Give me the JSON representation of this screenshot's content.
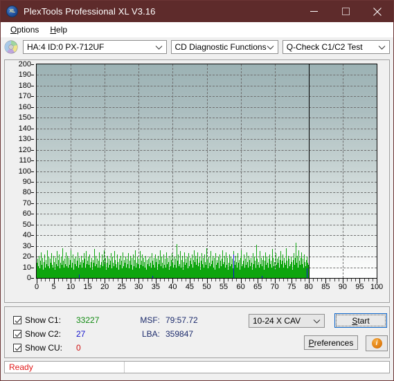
{
  "window": {
    "title": "PlexTools Professional XL V3.16",
    "app_icon": "xl-disc-icon",
    "icon_text": "XL",
    "minimize_label": "Minimize",
    "maximize_label": "Maximize",
    "close_label": "Close"
  },
  "menu": {
    "items": [
      {
        "label": "Options",
        "accel": "O"
      },
      {
        "label": "Help",
        "accel": "H"
      }
    ]
  },
  "toolbar": {
    "drive_select": "HA:4 ID:0  PX-712UF",
    "function_select": "CD Diagnostic Functions",
    "test_select": "Q-Check C1/C2 Test"
  },
  "stats": {
    "checkboxes": [
      {
        "label": "Show C1:",
        "value": "33227",
        "color": "#128a12",
        "checked": true
      },
      {
        "label": "Show C2:",
        "value": "27",
        "color": "#1212cc",
        "checked": true
      },
      {
        "label": "Show CU:",
        "value": "0",
        "color": "#d01010",
        "checked": true
      }
    ],
    "msf_label": "MSF:",
    "msf_value": "79:57.72",
    "lba_label": "LBA:",
    "lba_value": "359847",
    "speed_select": "10-24 X CAV",
    "start_label": "Start",
    "start_accel": "S",
    "preferences_label": "Preferences",
    "preferences_accel": "P",
    "info_label": "i"
  },
  "statusbar": {
    "text": "Ready"
  },
  "chart_data": {
    "type": "bar",
    "title": "",
    "xlabel": "",
    "ylabel": "",
    "xlim": [
      0,
      100
    ],
    "ylim": [
      0,
      200
    ],
    "grid": true,
    "legend_position": "below-chart",
    "x_ticks": [
      0,
      5,
      10,
      15,
      20,
      25,
      30,
      35,
      40,
      45,
      50,
      55,
      60,
      65,
      70,
      75,
      80,
      85,
      90,
      95,
      100
    ],
    "y_ticks": [
      0,
      10,
      20,
      30,
      40,
      50,
      60,
      70,
      80,
      90,
      100,
      110,
      120,
      130,
      140,
      150,
      160,
      170,
      180,
      190,
      200
    ],
    "x_minor_step": 1.25,
    "data_end_x": 80,
    "marker_lines_x": [
      80
    ],
    "plot_bg_top": "#9cb2b4",
    "plot_bg_bottom": "#ffffff",
    "series": [
      {
        "name": "C1",
        "color": "#0ea50e",
        "total": 33227,
        "note": "dense per-sample C1 error rate, mostly 6-26, occasional peaks to 33",
        "values": [
          14,
          18,
          11,
          21,
          9,
          16,
          24,
          12,
          19,
          8,
          15,
          22,
          10,
          17,
          13,
          26,
          11,
          20,
          9,
          18,
          14,
          23,
          12,
          16,
          10,
          21,
          15,
          8,
          19,
          13,
          25,
          11,
          17,
          22,
          9,
          14,
          20,
          12,
          28,
          16,
          10,
          18,
          13,
          24,
          11,
          21,
          9,
          15,
          19,
          12,
          17,
          26,
          10,
          14,
          22,
          8,
          18,
          13,
          20,
          11,
          16,
          24,
          9,
          19,
          12,
          15,
          21,
          10,
          17,
          14,
          23,
          11,
          18,
          9,
          25,
          13,
          16,
          20,
          12,
          22,
          10,
          15,
          19,
          8,
          17,
          14,
          27,
          11,
          21,
          13,
          18,
          10,
          16,
          24,
          9,
          20,
          12,
          15,
          22,
          11,
          17,
          26,
          13,
          19,
          8,
          14,
          21,
          10,
          18,
          12,
          16,
          23,
          9,
          20,
          14,
          11,
          25,
          17,
          13,
          19,
          10,
          22,
          15,
          8,
          18,
          12,
          21,
          16,
          9,
          24,
          11,
          17,
          14,
          20,
          10,
          18,
          13,
          23,
          9,
          16,
          21,
          12,
          19,
          15,
          8,
          22,
          11,
          17,
          26,
          10,
          14,
          20,
          13,
          18,
          9,
          25,
          12,
          16,
          22,
          11,
          19,
          15,
          10,
          21,
          8,
          17,
          24,
          13,
          18,
          11,
          20,
          14,
          9,
          23,
          16,
          12,
          19,
          10,
          22,
          15,
          18,
          8,
          21,
          13,
          17,
          26,
          11,
          20,
          14,
          9,
          16,
          22,
          12,
          18,
          10,
          24,
          13,
          19,
          15,
          8,
          21,
          11,
          17,
          23,
          14,
          10,
          20,
          12,
          18,
          9,
          32,
          16,
          22,
          11,
          19,
          13,
          25,
          10,
          17,
          21,
          8,
          15,
          24,
          12,
          18,
          14,
          20,
          9,
          23,
          11,
          16,
          19,
          13,
          22,
          10,
          17,
          26,
          15,
          9,
          21,
          12,
          18,
          24,
          11,
          14,
          20,
          8,
          16,
          23,
          13,
          19,
          10,
          22,
          15,
          12,
          28,
          17,
          9,
          20,
          14,
          11,
          25,
          18,
          13,
          16,
          21,
          10,
          19,
          8,
          23,
          12,
          17,
          14,
          20,
          9,
          22,
          16,
          11,
          18,
          26,
          13,
          15,
          21,
          10,
          24,
          12,
          17,
          19,
          8,
          14,
          22,
          11,
          20,
          13,
          18,
          9,
          25,
          16,
          12,
          21,
          15,
          10,
          23,
          14,
          17,
          8,
          19,
          26,
          11,
          20,
          13,
          16,
          22,
          9,
          18,
          12,
          24,
          15,
          10,
          21,
          17,
          11,
          19,
          14,
          8,
          23,
          13,
          20,
          16,
          9,
          31,
          18,
          12,
          22,
          15,
          10,
          25,
          13,
          19,
          11,
          17,
          21,
          8,
          16,
          24,
          12,
          20,
          14,
          9,
          18,
          22,
          13,
          16,
          10,
          27,
          19,
          11,
          21,
          15,
          8,
          23,
          12,
          18,
          14,
          20,
          9,
          17,
          25,
          13,
          16,
          22,
          10,
          19,
          14,
          12,
          28,
          16,
          9,
          21,
          18,
          11,
          24,
          13,
          20,
          15,
          8,
          17,
          23,
          12,
          19,
          33,
          14,
          21,
          10,
          26,
          16,
          12,
          19,
          24,
          13,
          18,
          9,
          22,
          15,
          11,
          29,
          17,
          20,
          14,
          12
        ]
      },
      {
        "name": "C2",
        "color": "#1212dd",
        "total": 27,
        "note": "isolated tall blue spikes plus small baseline ticks",
        "spikes": [
          {
            "x": 57.8,
            "y": 22
          },
          {
            "x": 79.4,
            "y": 9
          },
          {
            "x": 12.5,
            "y": 3
          },
          {
            "x": 34.1,
            "y": 2
          },
          {
            "x": 66.2,
            "y": 2
          }
        ]
      },
      {
        "name": "CU",
        "color": "#d01010",
        "total": 0,
        "values": []
      }
    ]
  }
}
